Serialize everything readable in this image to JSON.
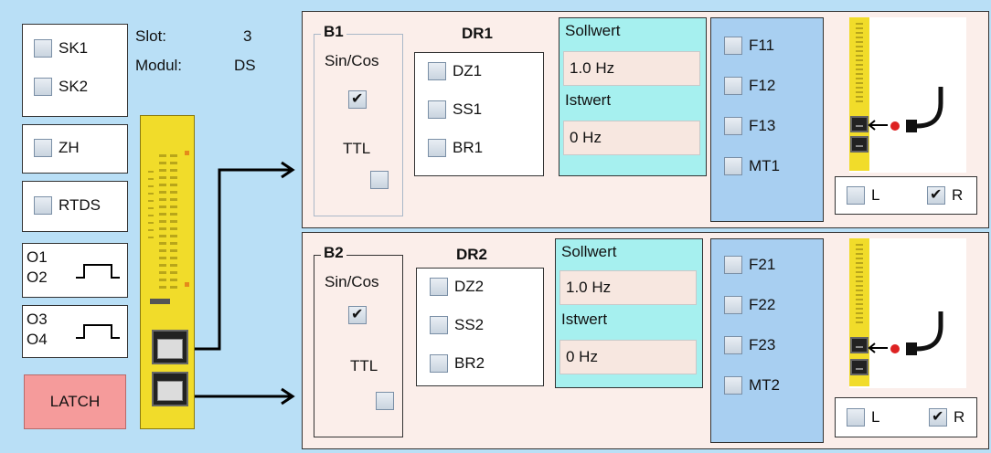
{
  "left": {
    "sk1": "SK1",
    "sk2": "SK2",
    "zh": "ZH",
    "rtds": "RTDS",
    "o1": "O1",
    "o2": "O2",
    "o3": "O3",
    "o4": "O4",
    "latch": "LATCH",
    "slot_label": "Slot:",
    "slot_value": "3",
    "modul_label": "Modul:",
    "modul_value": "DS"
  },
  "channels": [
    {
      "b_title": "B1",
      "sincos": "Sin/Cos",
      "sincos_checked": true,
      "ttl": "TTL",
      "ttl_checked": false,
      "dr_title": "DR1",
      "dz": "DZ1",
      "ss": "SS1",
      "br": "BR1",
      "sollwert_label": "Sollwert",
      "sollwert": "1.0 Hz",
      "istwert_label": "Istwert",
      "istwert": "0 Hz",
      "f1": "F11",
      "f2": "F12",
      "f3": "F13",
      "mt": "MT1",
      "l": "L",
      "l_checked": false,
      "r": "R",
      "r_checked": true
    },
    {
      "b_title": "B2",
      "sincos": "Sin/Cos",
      "sincos_checked": true,
      "ttl": "TTL",
      "ttl_checked": false,
      "dr_title": "DR2",
      "dz": "DZ2",
      "ss": "SS2",
      "br": "BR2",
      "sollwert_label": "Sollwert",
      "sollwert": "1.0 Hz",
      "istwert_label": "Istwert",
      "istwert": "0 Hz",
      "f1": "F21",
      "f2": "F22",
      "f3": "F23",
      "mt": "MT2",
      "l": "L",
      "l_checked": false,
      "r": "R",
      "r_checked": true
    }
  ],
  "colors": {
    "background": "#b9dff6",
    "panel": "#fbeeea",
    "cyan": "#a6f0ef",
    "blue": "#a8cff1",
    "latch": "#f59b9b",
    "module": "#f1dc2a"
  }
}
